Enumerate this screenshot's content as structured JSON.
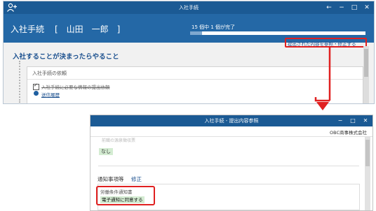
{
  "main_window": {
    "title": "入社手続",
    "controls": {
      "back": "←",
      "minimize": "−",
      "maximize": "□",
      "close": "✕"
    },
    "header": {
      "label": "入社手続",
      "employee_name": "[　山田　一郎　]",
      "progress_text": "15 個中 1 個が完了",
      "progress_fraction": 0.067
    },
    "reference_link": "提出された内容を参照・修正する",
    "section_heading": "入社することが決まったらやること",
    "card": {
      "title": "入社手続の依頼",
      "task_label": "入社手続に必要な情報の提出依頼",
      "send_history_link": "送信履歴"
    }
  },
  "sub_window": {
    "title": "入社手続 - 提出内容参照",
    "controls": {
      "minimize": "−",
      "maximize": "□",
      "close": "✕"
    },
    "company": "OBC商事株式会社",
    "cutoff_label": "前職の源泉徴収票",
    "prev_value": "なし",
    "notice_heading": "通知事項等",
    "fix_link": "修正",
    "item_label": "労働条件通知書",
    "item_value": "電子通知に同意する"
  },
  "colors": {
    "titlebar": "#1b5a94",
    "header": "#2468a6",
    "highlight": "#e02020",
    "badge": "#d4ecd2"
  },
  "icons": {
    "app": "add-user-icon",
    "send": "send-history-icon",
    "arrow": "down-arrow-icon"
  }
}
